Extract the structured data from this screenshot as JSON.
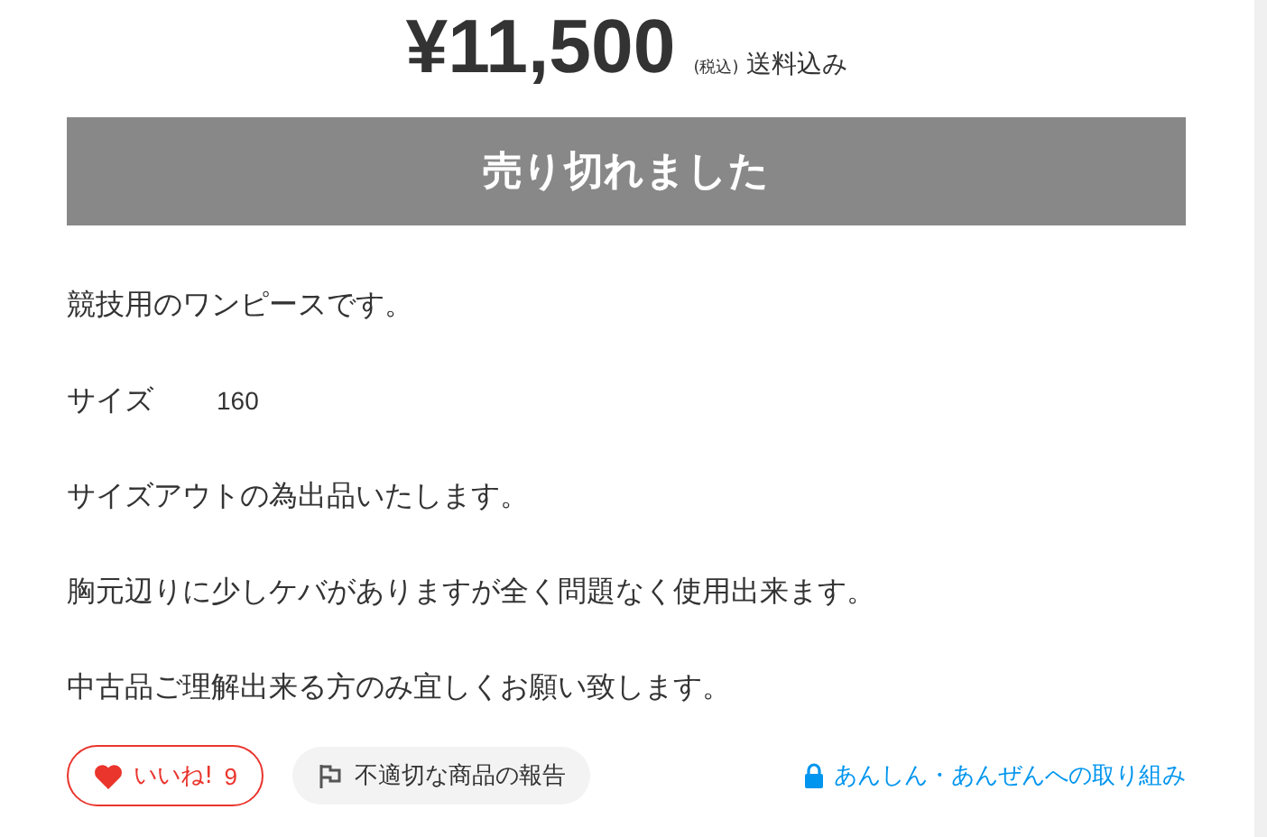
{
  "price": {
    "amount": "¥11,500",
    "tax_note": "(税込)",
    "shipping": "送料込み"
  },
  "sold_out_button": {
    "label": "売り切れました",
    "disabled": true
  },
  "description": [
    {
      "kind": "text",
      "text": "競技用のワンピースです。"
    },
    {
      "kind": "spec",
      "label": "サイズ",
      "value": "160"
    },
    {
      "kind": "text",
      "text": "サイズアウトの為出品いたします。"
    },
    {
      "kind": "text",
      "text": "胸元辺りに少しケバがありますが全く問題なく使用出来ます。"
    },
    {
      "kind": "text",
      "text": "中古品ご理解出来る方のみ宜しくお願い致します。"
    }
  ],
  "actions": {
    "like": {
      "label": "いいね!",
      "count": "9",
      "liked": false
    },
    "report": {
      "label": "不適切な商品の報告"
    },
    "safety_link": {
      "label": "あんしん・あんぜんへの取り組み"
    }
  }
}
